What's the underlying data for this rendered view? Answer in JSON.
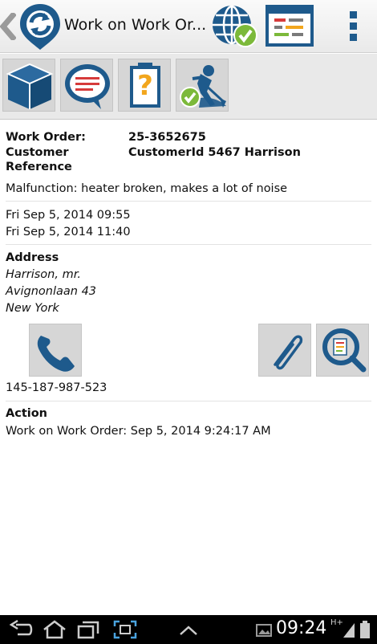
{
  "app": {
    "title": "Work on Work Or...",
    "icons": {
      "logo": "sync-logo-icon",
      "globe": "globe-check-icon",
      "list": "task-list-icon",
      "overflow": "overflow-menu-icon",
      "up": "chevron-left-icon"
    }
  },
  "toolbar": {
    "items": [
      {
        "name": "box-icon"
      },
      {
        "name": "message-bubble-icon"
      },
      {
        "name": "help-clipboard-icon"
      },
      {
        "name": "worker-complete-icon"
      }
    ]
  },
  "work_order": {
    "work_order_label": "Work Order:",
    "work_order_value": "25-3652675",
    "customer_ref_label_1": "Customer",
    "customer_ref_label_2": "Reference",
    "customer_ref_value": "CustomerId 5467 Harrison",
    "description": "Malfunction: heater broken, makes a lot of noise",
    "date_start": "Fri Sep 5, 2014 09:55",
    "date_end": "Fri Sep 5, 2014 11:40"
  },
  "address": {
    "heading": "Address",
    "line1": "Harrison, mr.",
    "line2": "Avignonlaan 43",
    "line3": "New York"
  },
  "contact": {
    "phone": "145-187-987-523"
  },
  "action": {
    "heading": "Action",
    "text": "Work on Work Order: Sep 5, 2014 9:24:17 AM"
  },
  "system": {
    "time": "09:24",
    "network": "H+"
  },
  "colors": {
    "brand_blue": "#1e5a8c",
    "check_green": "#7cb93a",
    "orange": "#f2a61d",
    "red": "#d63b3b"
  }
}
